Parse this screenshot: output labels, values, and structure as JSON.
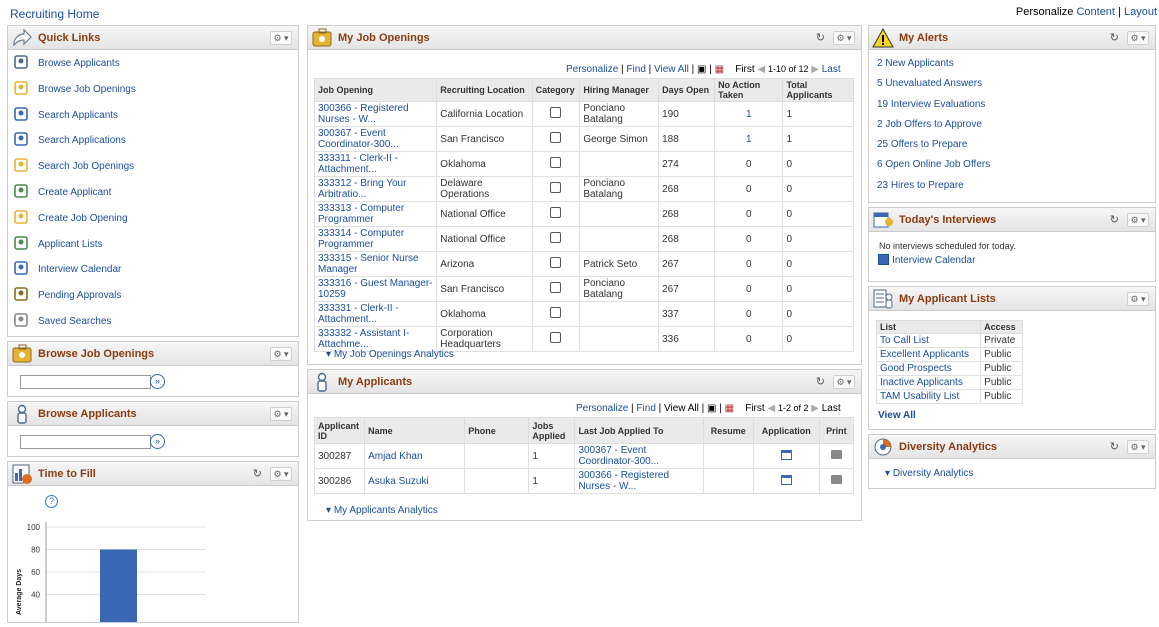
{
  "header": {
    "title": "Recruiting Home",
    "personalize": "Personalize",
    "content": "Content",
    "sep": "|",
    "layout": "Layout"
  },
  "quick_links": {
    "title": "Quick Links",
    "items": [
      {
        "label": "Browse Applicants",
        "icon": "person-icon"
      },
      {
        "label": "Browse Job Openings",
        "icon": "job-openings-icon"
      },
      {
        "label": "Search Applicants",
        "icon": "search-person-icon"
      },
      {
        "label": "Search Applications",
        "icon": "search-doc-icon"
      },
      {
        "label": "Search Job Openings",
        "icon": "search-jobs-icon"
      },
      {
        "label": "Create Applicant",
        "icon": "add-person-icon"
      },
      {
        "label": "Create Job Opening",
        "icon": "add-job-icon"
      },
      {
        "label": "Applicant Lists",
        "icon": "list-icon"
      },
      {
        "label": "Interview Calendar",
        "icon": "calendar-icon"
      },
      {
        "label": "Pending Approvals",
        "icon": "approval-icon"
      },
      {
        "label": "Saved Searches",
        "icon": "saved-search-icon"
      }
    ]
  },
  "browse_job_openings": {
    "title": "Browse Job Openings",
    "value": ""
  },
  "browse_applicants": {
    "title": "Browse Applicants",
    "value": ""
  },
  "time_to_fill": {
    "title": "Time to Fill",
    "help": "?"
  },
  "chart_data": {
    "type": "bar",
    "categories": [
      ""
    ],
    "values": [
      80
    ],
    "title": "",
    "xlabel": "",
    "ylabel": "Average Days",
    "ylim": [
      0,
      100
    ],
    "yticks": [
      40,
      60,
      80,
      100
    ],
    "bar_color": "#3a68b4"
  },
  "job_openings": {
    "title": "My Job Openings",
    "nav": {
      "personalize": "Personalize",
      "find": "Find",
      "view_all": "View All",
      "first": "First",
      "range": "1-10 of 12",
      "last": "Last"
    },
    "columns": [
      "Job Opening",
      "Recruiting Location",
      "Category",
      "Hiring Manager",
      "Days Open",
      "No Action Taken",
      "Total Applicants"
    ],
    "rows": [
      {
        "job": "300366 - Registered Nurses - W...",
        "location": "California Location",
        "manager": "Ponciano Batalang",
        "days": "190",
        "no_action": "1",
        "total": "1"
      },
      {
        "job": "300367 - Event Coordinator-300...",
        "location": "San Francisco",
        "manager": "George Simon",
        "days": "188",
        "no_action": "1",
        "total": "1"
      },
      {
        "job": "333311 - Clerk-II - Attachment...",
        "location": "Oklahoma",
        "manager": "",
        "days": "274",
        "no_action": "0",
        "total": "0"
      },
      {
        "job": "333312 - Bring Your Arbitratio...",
        "location": "Delaware Operations",
        "manager": "Ponciano Batalang",
        "days": "268",
        "no_action": "0",
        "total": "0"
      },
      {
        "job": "333313 - Computer Programmer",
        "location": "National Office",
        "manager": "",
        "days": "268",
        "no_action": "0",
        "total": "0"
      },
      {
        "job": "333314 - Computer Programmer",
        "location": "National Office",
        "manager": "",
        "days": "268",
        "no_action": "0",
        "total": "0"
      },
      {
        "job": "333315 - Senior Nurse Manager",
        "location": "Arizona",
        "manager": "Patrick Seto",
        "days": "267",
        "no_action": "0",
        "total": "0"
      },
      {
        "job": "333316 - Guest Manager-10259",
        "location": "San Francisco",
        "manager": "Ponciano Batalang",
        "days": "267",
        "no_action": "0",
        "total": "0"
      },
      {
        "job": "333331 - Clerk-II - Attachment...",
        "location": "Oklahoma",
        "manager": "",
        "days": "337",
        "no_action": "0",
        "total": "0"
      },
      {
        "job": "333332 - Assistant I- Attachme...",
        "location": "Corporation Headquarters",
        "manager": "",
        "days": "336",
        "no_action": "0",
        "total": "0"
      }
    ],
    "analytics": "My Job Openings Analytics"
  },
  "my_applicants": {
    "title": "My Applicants",
    "nav": {
      "personalize": "Personalize",
      "find": "Find",
      "view_all": "View All",
      "first": "First",
      "range": "1-2 of 2",
      "last": "Last"
    },
    "columns": [
      "Applicant ID",
      "Name",
      "Phone",
      "Jobs Applied",
      "Last Job Applied To",
      "Resume",
      "Application",
      "Print"
    ],
    "rows": [
      {
        "id": "300287",
        "name": "Amjad Khan",
        "phone": "",
        "jobs": "1",
        "last_job": "300367 - Event Coordinator-300..."
      },
      {
        "id": "300286",
        "name": "Asuka Suzuki",
        "phone": "",
        "jobs": "1",
        "last_job": "300366 - Registered Nurses - W..."
      }
    ],
    "analytics": "My Applicants Analytics"
  },
  "alerts": {
    "title": "My Alerts",
    "items": [
      "2 New Applicants",
      "5 Unevaluated Answers",
      "19 Interview Evaluations",
      "2 Job Offers to Approve",
      "25 Offers to Prepare",
      "6 Open Online Job Offers",
      "23 Hires to Prepare"
    ]
  },
  "interviews": {
    "title": "Today's Interviews",
    "message": "No interviews scheduled for today.",
    "calendar_link": "Interview Calendar"
  },
  "applicant_lists": {
    "title": "My Applicant Lists",
    "columns": [
      "List",
      "Access"
    ],
    "rows": [
      {
        "list": "To Call List",
        "access": "Private"
      },
      {
        "list": "Excellent Applicants",
        "access": "Public"
      },
      {
        "list": "Good Prospects",
        "access": "Public"
      },
      {
        "list": "Inactive Applicants",
        "access": "Public"
      },
      {
        "list": "TAM Usability List",
        "access": "Public"
      }
    ],
    "view_all": "View All"
  },
  "diversity": {
    "title": "Diversity Analytics",
    "link": "Diversity Analytics"
  },
  "colors": {
    "accent": "#1a4f9c",
    "title_text": "#8a3b0f",
    "bar": "#3a68b4"
  }
}
